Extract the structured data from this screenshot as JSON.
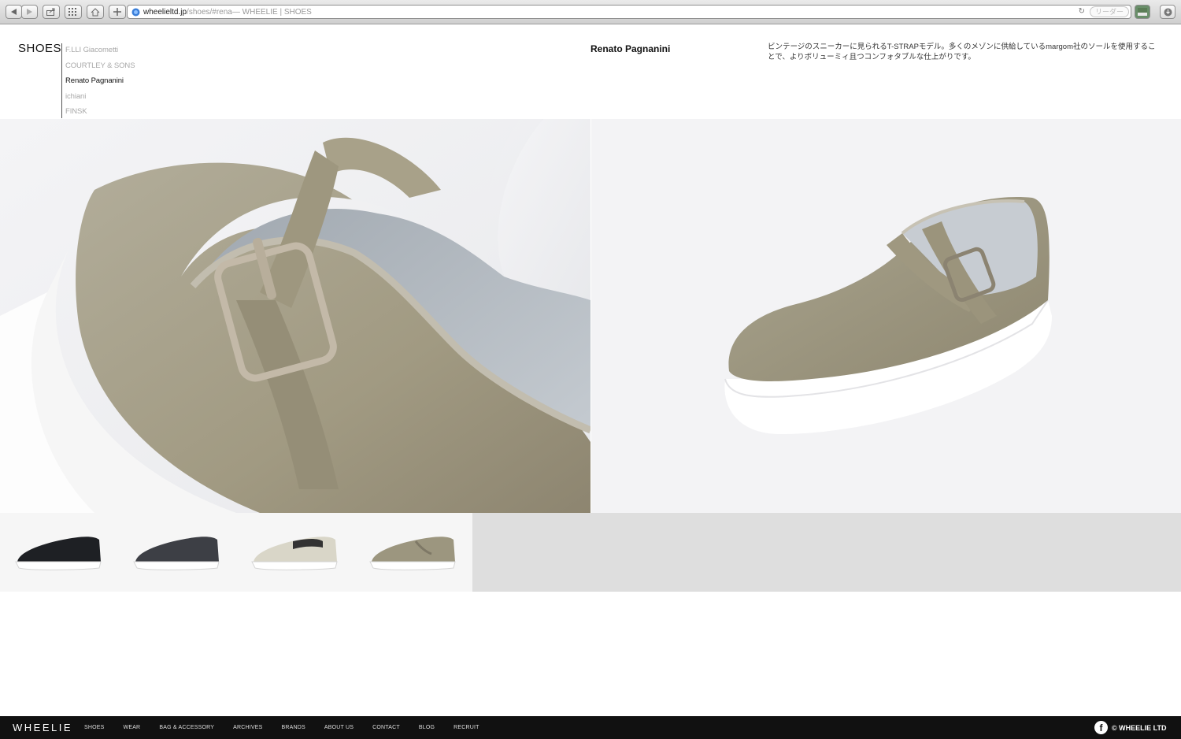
{
  "browser": {
    "url_host": "wheelieltd.jp",
    "url_path": "/shoes/#rena",
    "page_title": " — WHEELIE | SHOES",
    "reader_label": "リーダー"
  },
  "page": {
    "section_title": "SHOES",
    "brands": [
      "F.LLI Giacometti",
      "COURTLEY & SONS",
      "Renato Pagnanini",
      "ichiani",
      "FINSK"
    ],
    "active_brand": "Renato Pagnanini",
    "product_name": "Renato Pagnanini",
    "description": "ビンテージのスニーカーに見られるT-STRAPモデル。多くのメゾンに供給しているmargom社のソールを使用することで、よりボリューミィ且つコンフォタブルな仕上がりです。"
  },
  "thumbnails": [
    {
      "name": "black-slip-on",
      "upper": "#1e2024"
    },
    {
      "name": "woven-slip-on",
      "upper": "#3d3f45"
    },
    {
      "name": "mesh-slip-on",
      "upper": "#d9d6c8"
    },
    {
      "name": "t-strap",
      "upper": "#9c967f"
    }
  ],
  "footer": {
    "logo": "WHEELIE",
    "nav": [
      "SHOES",
      "WEAR",
      "BAG & ACCESSORY",
      "ARCHIVES",
      "BRANDS",
      "ABOUT US",
      "CONTACT",
      "BLOG",
      "RECRUIT"
    ],
    "copyright": "© WHEELIE LTD"
  },
  "colors": {
    "suede": "#a29c86",
    "footer_bg": "#111111",
    "inactive_text": "#a8a8a8"
  }
}
